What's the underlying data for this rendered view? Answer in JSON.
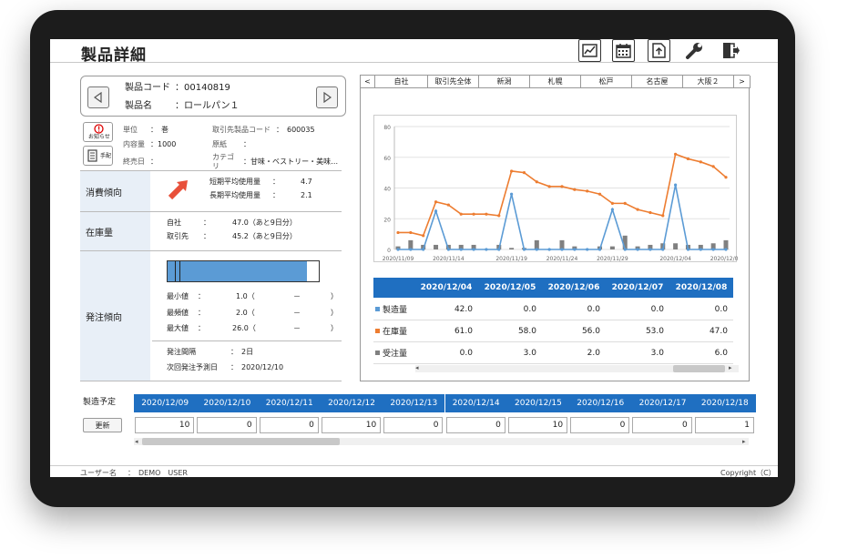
{
  "page": {
    "title": "製品詳細"
  },
  "toolbar": {
    "icons": [
      "chart-image-icon",
      "calendar-icon",
      "upload-icon",
      "wrench-icon",
      "exit-icon"
    ]
  },
  "product": {
    "code_label": "製品コード",
    "code": "：00140819",
    "name_label": "製品名",
    "name": "：ロールパン１"
  },
  "notice": {
    "label": "お知らせ"
  },
  "handbook": {
    "label": "手配"
  },
  "info": {
    "unit_label": "単位",
    "unit": "：　巻",
    "content_label": "内容量",
    "content": "：1000",
    "end_label": "終売日",
    "end": "：",
    "supplier_code_label": "取引先製品コード",
    "supplier_code": "：　600035",
    "material_label": "原紙",
    "material": "：",
    "category_label": "カテゴリ",
    "category": "：甘味・ベストリー・美味…"
  },
  "consumption": {
    "label": "消費傾向",
    "short_label": "短期平均使用量",
    "short_colon": "：",
    "short_value": "4.7",
    "long_label": "長期平均使用量",
    "long_colon": "：",
    "long_value": "2.1",
    "trend": "up"
  },
  "stock": {
    "label": "在庫量",
    "own_label": "自社",
    "own_colon": "：",
    "own_value": "47.0（あと9日分）",
    "partner_label": "取引先",
    "partner_colon": "：",
    "partner_value": "45.2（あと9日分）"
  },
  "order": {
    "label": "発注傾向",
    "bar_fill": 0.92,
    "min_label": "最小値",
    "min_colon": "：",
    "min_value": "1.0（",
    "min_dash": "－",
    "min_close": "）",
    "mode_label": "最頻値",
    "mode_colon": "：",
    "mode_value": "2.0（",
    "mode_dash": "－",
    "mode_close": "）",
    "max_label": "最大値",
    "max_colon": "：",
    "max_value": "26.0（",
    "max_dash": "－",
    "max_close": "）",
    "interval_label": "発注間隔",
    "interval_value": "：　2日",
    "next_label": "次回発注予測日",
    "next_value": "：　2020/12/10"
  },
  "tabs": [
    "<",
    "自社",
    "取引先全体",
    "新潟",
    "札幌",
    "松戸",
    "名古屋",
    "大阪２",
    ">"
  ],
  "chart_data": {
    "type": "line",
    "y_ticks": [
      "0",
      "20",
      "40",
      "60",
      "80"
    ],
    "ylim": [
      0,
      80
    ],
    "x_ticks": [
      "2020/11/09",
      "2020/11/14",
      "2020/11/19",
      "2020/11/24",
      "2020/11/29",
      "2020/12/04",
      "2020/12/09"
    ],
    "grid": true,
    "series": [
      {
        "name": "在庫量",
        "color": "#ed7d31",
        "values": [
          11,
          11,
          9,
          31,
          29,
          23,
          23,
          23,
          22,
          51,
          50,
          44,
          41,
          41,
          39,
          38,
          36,
          30,
          30,
          26,
          24,
          22,
          62,
          59,
          57,
          54,
          47
        ]
      },
      {
        "name": "製造量",
        "color": "#5b9bd5",
        "values": [
          0,
          0,
          0,
          25,
          0,
          0,
          0,
          0,
          0,
          36,
          0,
          0,
          0,
          0,
          0,
          0,
          0,
          26,
          0,
          0,
          0,
          0,
          42,
          0,
          0,
          0,
          0
        ]
      },
      {
        "name": "受注量",
        "color": "#808080",
        "values": [
          2,
          6,
          3,
          3,
          3,
          3,
          3,
          0,
          3,
          1,
          1,
          6,
          0,
          6,
          2,
          0,
          2,
          2,
          9,
          2,
          3,
          4,
          4,
          3,
          3,
          4,
          6
        ]
      }
    ]
  },
  "detail": {
    "dates": [
      "2020/12/04",
      "2020/12/05",
      "2020/12/06",
      "2020/12/07",
      "2020/12/08"
    ],
    "rows": [
      {
        "label": "製造量",
        "color": "#5b9bd5",
        "values": [
          "42.0",
          "0.0",
          "0.0",
          "0.0",
          "0.0"
        ]
      },
      {
        "label": "在庫量",
        "color": "#ed7d31",
        "values": [
          "61.0",
          "58.0",
          "56.0",
          "53.0",
          "47.0"
        ]
      },
      {
        "label": "受注量",
        "color": "#808080",
        "values": [
          "0.0",
          "3.0",
          "2.0",
          "3.0",
          "6.0"
        ]
      }
    ]
  },
  "schedule": {
    "label": "製造予定",
    "update_button": "更新",
    "dates": [
      "2020/12/09",
      "2020/12/10",
      "2020/12/11",
      "2020/12/12",
      "2020/12/13",
      "2020/12/14",
      "2020/12/15",
      "2020/12/16",
      "2020/12/17",
      "2020/12/18"
    ],
    "values": [
      "10",
      "0",
      "0",
      "10",
      "0",
      "0",
      "10",
      "0",
      "0",
      "1"
    ]
  },
  "footer": {
    "user_label": "ユーザー名",
    "user_value": "：　DEMO　USER",
    "copyright": "Copyright（C）"
  }
}
